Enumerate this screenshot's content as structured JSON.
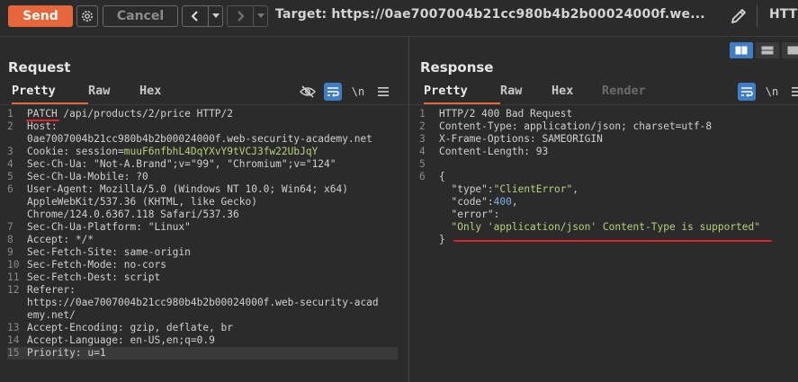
{
  "toolbar": {
    "send_label": "Send",
    "cancel_label": "Cancel",
    "back_icon": "chevron-left",
    "forward_icon": "chevron-right",
    "target_text": "Target: https://0ae7007004b21cc980b4b2b00024000f.we...",
    "http_cut": "HTTP"
  },
  "request": {
    "title": "Request",
    "tabs": [
      "Pretty",
      "Raw",
      "Hex"
    ],
    "tools": {
      "newline_label": "\\n"
    },
    "lines": [
      {
        "n": "1",
        "parts": [
          [
            "k",
            "PATCH"
          ],
          [
            "v",
            " /api/products/2/price HTTP/2"
          ]
        ]
      },
      {
        "n": "2",
        "parts": [
          [
            "k",
            "Host:"
          ]
        ]
      },
      {
        "n": "",
        "parts": [
          [
            "v",
            "0ae7007004b21cc980b4b2b00024000f.web-security-academy.net"
          ]
        ]
      },
      {
        "n": "3",
        "parts": [
          [
            "k",
            "Cookie: session="
          ],
          [
            "cookie",
            "muuF6nfbhL4DqYXvY9tVCJ3fw22UbJqY"
          ]
        ]
      },
      {
        "n": "4",
        "parts": [
          [
            "k",
            "Sec-Ch-Ua: "
          ],
          [
            "v",
            "\"Not-A.Brand\";v=\"99\", \"Chromium\";v=\"124\""
          ]
        ]
      },
      {
        "n": "5",
        "parts": [
          [
            "k",
            "Sec-Ch-Ua-Mobile: "
          ],
          [
            "v",
            "?0"
          ]
        ]
      },
      {
        "n": "6",
        "parts": [
          [
            "k",
            "User-Agent: "
          ],
          [
            "v",
            "Mozilla/5.0 (Windows NT 10.0; Win64; x64)"
          ]
        ]
      },
      {
        "n": "",
        "parts": [
          [
            "v",
            "AppleWebKit/537.36 (KHTML, like Gecko)"
          ]
        ]
      },
      {
        "n": "",
        "parts": [
          [
            "v",
            "Chrome/124.0.6367.118 Safari/537.36"
          ]
        ]
      },
      {
        "n": "7",
        "parts": [
          [
            "k",
            "Sec-Ch-Ua-Platform: "
          ],
          [
            "v",
            "\"Linux\""
          ]
        ]
      },
      {
        "n": "8",
        "parts": [
          [
            "k",
            "Accept: "
          ],
          [
            "v",
            "*/*"
          ]
        ]
      },
      {
        "n": "9",
        "parts": [
          [
            "k",
            "Sec-Fetch-Site: "
          ],
          [
            "v",
            "same-origin"
          ]
        ]
      },
      {
        "n": "10",
        "parts": [
          [
            "k",
            "Sec-Fetch-Mode: "
          ],
          [
            "v",
            "no-cors"
          ]
        ]
      },
      {
        "n": "11",
        "parts": [
          [
            "k",
            "Sec-Fetch-Dest: "
          ],
          [
            "v",
            "script"
          ]
        ]
      },
      {
        "n": "12",
        "parts": [
          [
            "k",
            "Referer:"
          ]
        ]
      },
      {
        "n": "",
        "parts": [
          [
            "v",
            "https://0ae7007004b21cc980b4b2b00024000f.web-security-acad"
          ]
        ]
      },
      {
        "n": "",
        "parts": [
          [
            "v",
            "emy.net/"
          ]
        ]
      },
      {
        "n": "13",
        "parts": [
          [
            "k",
            "Accept-Encoding: "
          ],
          [
            "v",
            "gzip, deflate, br"
          ]
        ]
      },
      {
        "n": "14",
        "parts": [
          [
            "k",
            "Accept-Language: "
          ],
          [
            "v",
            "en-US,en;q=0.9"
          ]
        ]
      },
      {
        "n": "15",
        "parts": [
          [
            "k",
            "Priority: "
          ],
          [
            "v",
            "u=1"
          ]
        ],
        "highlight": true
      }
    ]
  },
  "response": {
    "title": "Response",
    "tabs": [
      "Pretty",
      "Raw",
      "Hex",
      "Render"
    ],
    "tools": {
      "newline_label": "\\n"
    },
    "lines": [
      {
        "n": "1",
        "parts": [
          [
            "v",
            "HTTP/2 400 Bad Request"
          ]
        ]
      },
      {
        "n": "2",
        "parts": [
          [
            "k",
            "Content-Type: "
          ],
          [
            "v",
            "application/json; charset=utf-8"
          ]
        ]
      },
      {
        "n": "3",
        "parts": [
          [
            "k",
            "X-Frame-Options: "
          ],
          [
            "v",
            "SAMEORIGIN"
          ]
        ]
      },
      {
        "n": "4",
        "parts": [
          [
            "k",
            "Content-Length: "
          ],
          [
            "v",
            "93"
          ]
        ]
      },
      {
        "n": "5",
        "parts": []
      },
      {
        "n": "6",
        "parts": [
          [
            "v",
            "{"
          ]
        ]
      },
      {
        "n": "",
        "parts": [
          [
            "v",
            "  "
          ],
          [
            "jk",
            "\"type\""
          ],
          [
            "v",
            ":"
          ],
          [
            "js",
            "\"ClientError\""
          ],
          [
            "v",
            ","
          ]
        ]
      },
      {
        "n": "",
        "parts": [
          [
            "v",
            "  "
          ],
          [
            "jk",
            "\"code\""
          ],
          [
            "v",
            ":"
          ],
          [
            "jn",
            "400"
          ],
          [
            "v",
            ","
          ]
        ]
      },
      {
        "n": "",
        "parts": [
          [
            "v",
            "  "
          ],
          [
            "jk",
            "\"error\""
          ],
          [
            "v",
            ":"
          ]
        ]
      },
      {
        "n": "",
        "parts": [
          [
            "v",
            "  "
          ],
          [
            "js",
            "\"Only 'application/json' Content-Type is supported\""
          ]
        ]
      },
      {
        "n": "",
        "parts": [
          [
            "v",
            "}"
          ]
        ]
      }
    ]
  },
  "colors": {
    "send": "#e8673a",
    "active_tab_underline": "#e8673a",
    "toggle_active": "#3f7dc7",
    "annotation_red": "#e0232b",
    "string_green": "#b8d17a",
    "number_blue": "#7fb2e6"
  },
  "icons": {
    "settings": "gear-icon",
    "edit": "pencil-icon",
    "hide": "eye-slash-icon",
    "wrap": "wrap-icon",
    "menu": "hamburger-icon"
  }
}
